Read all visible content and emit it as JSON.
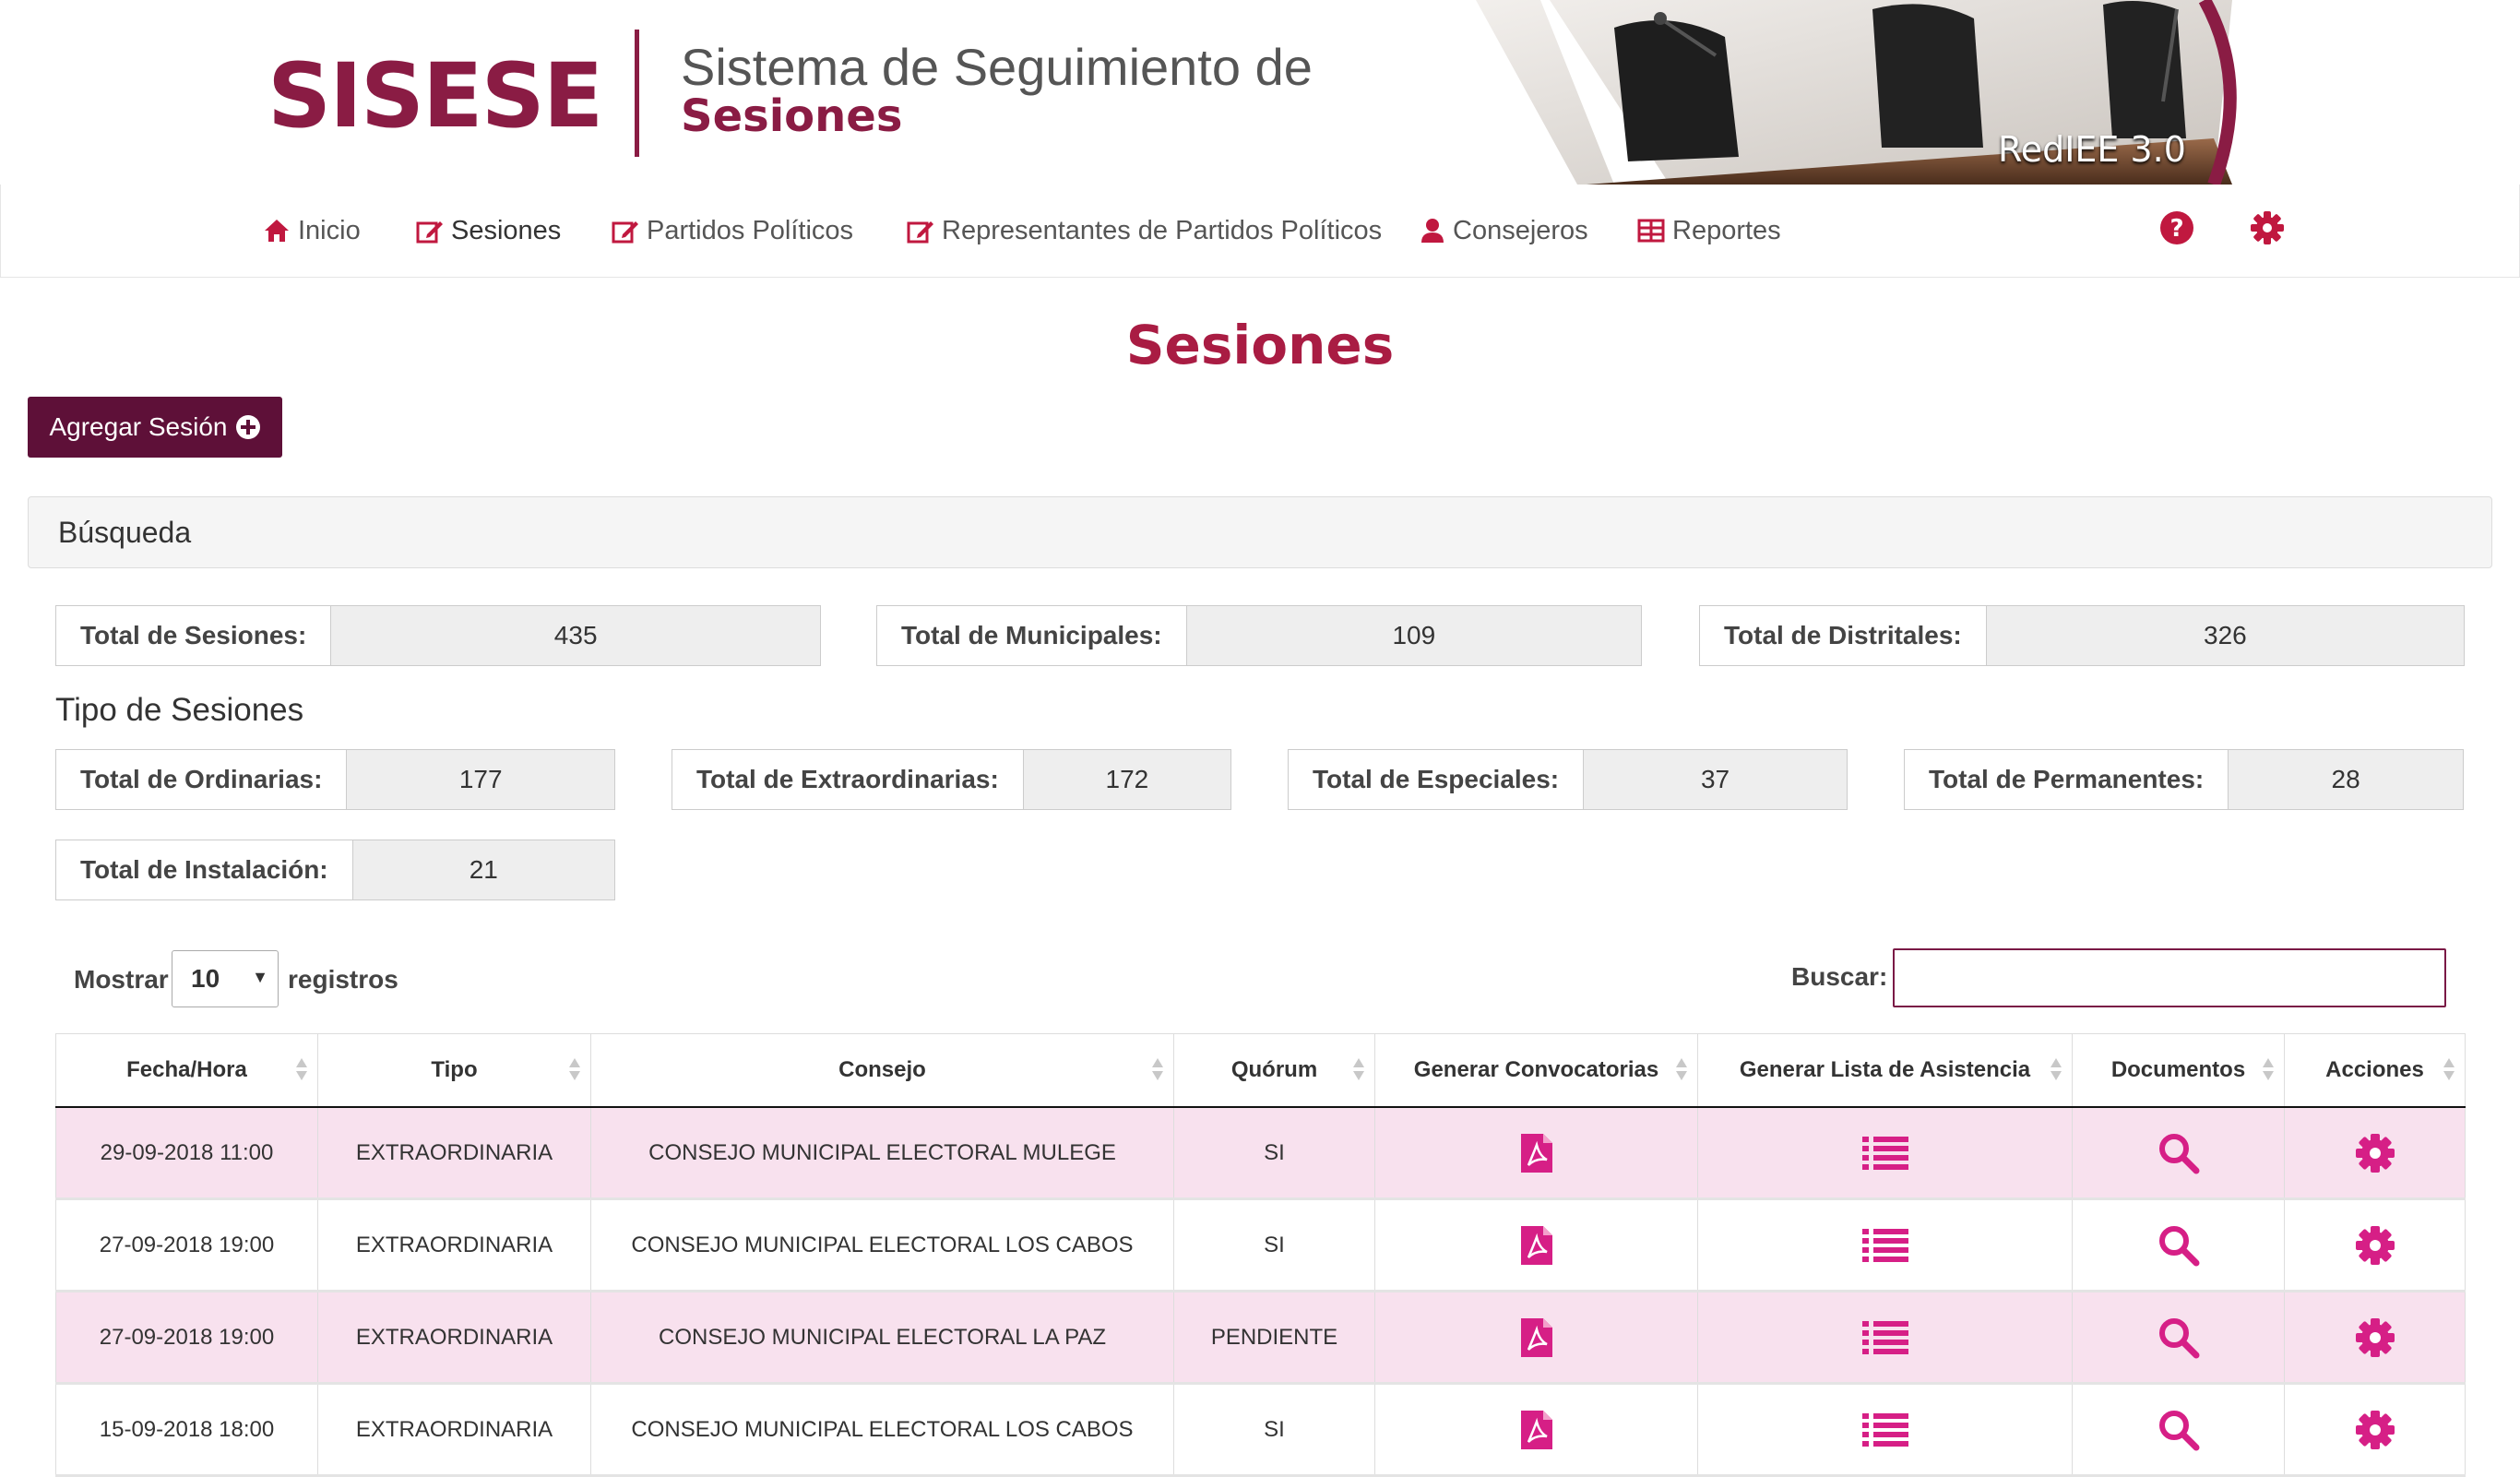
{
  "header": {
    "logo": "SISESE",
    "subtitle_line1": "Sistema de Seguimiento de",
    "subtitle_line2": "Sesiones",
    "badge": "RedIEE 3.0"
  },
  "nav": {
    "items": [
      {
        "label": "Inicio",
        "icon": "home-icon"
      },
      {
        "label": "Sesiones",
        "icon": "edit-icon"
      },
      {
        "label": "Partidos Políticos",
        "icon": "edit-icon"
      },
      {
        "label": "Representantes de Partidos Políticos",
        "icon": "edit-icon"
      },
      {
        "label": "Consejeros",
        "icon": "user-icon"
      },
      {
        "label": "Reportes",
        "icon": "table-icon"
      }
    ],
    "tools": [
      "help-icon",
      "gear-icon"
    ]
  },
  "page": {
    "title": "Sesiones",
    "add_button": "Agregar Sesión"
  },
  "search_panel": {
    "title": "Búsqueda"
  },
  "totals": {
    "sesiones": {
      "label": "Total de Sesiones:",
      "value": "435"
    },
    "municipales": {
      "label": "Total de Municipales:",
      "value": "109"
    },
    "distritales": {
      "label": "Total de Distritales:",
      "value": "326"
    }
  },
  "tipo": {
    "heading": "Tipo de Sesiones",
    "ordinarias": {
      "label": "Total de Ordinarias:",
      "value": "177"
    },
    "extraordinarias": {
      "label": "Total de Extraordinarias:",
      "value": "172"
    },
    "especiales": {
      "label": "Total de Especiales:",
      "value": "37"
    },
    "permanentes": {
      "label": "Total de Permanentes:",
      "value": "28"
    },
    "instalacion": {
      "label": "Total de Instalación:",
      "value": "21"
    }
  },
  "table_controls": {
    "show_label": "Mostrar",
    "length_value": "10",
    "records_label": "registros",
    "search_label": "Buscar:",
    "search_value": ""
  },
  "table": {
    "columns": [
      "Fecha/Hora",
      "Tipo",
      "Consejo",
      "Quórum",
      "Generar Convocatorias",
      "Generar Lista de Asistencia",
      "Documentos",
      "Acciones"
    ],
    "rows": [
      {
        "fecha": "29-09-2018 11:00",
        "tipo": "EXTRAORDINARIA",
        "consejo": "CONSEJO MUNICIPAL ELECTORAL MULEGE",
        "quorum": "SI"
      },
      {
        "fecha": "27-09-2018 19:00",
        "tipo": "EXTRAORDINARIA",
        "consejo": "CONSEJO MUNICIPAL ELECTORAL LOS CABOS",
        "quorum": "SI"
      },
      {
        "fecha": "27-09-2018 19:00",
        "tipo": "EXTRAORDINARIA",
        "consejo": "CONSEJO MUNICIPAL ELECTORAL LA PAZ",
        "quorum": "PENDIENTE"
      },
      {
        "fecha": "15-09-2018 18:00",
        "tipo": "EXTRAORDINARIA",
        "consejo": "CONSEJO MUNICIPAL ELECTORAL LOS CABOS",
        "quorum": "SI"
      }
    ]
  },
  "colors": {
    "brand": "#8a1c44",
    "title": "#a91c43",
    "button": "#5e1038",
    "icon": "#d61f86",
    "row_stripe": "#f8e1ee"
  }
}
